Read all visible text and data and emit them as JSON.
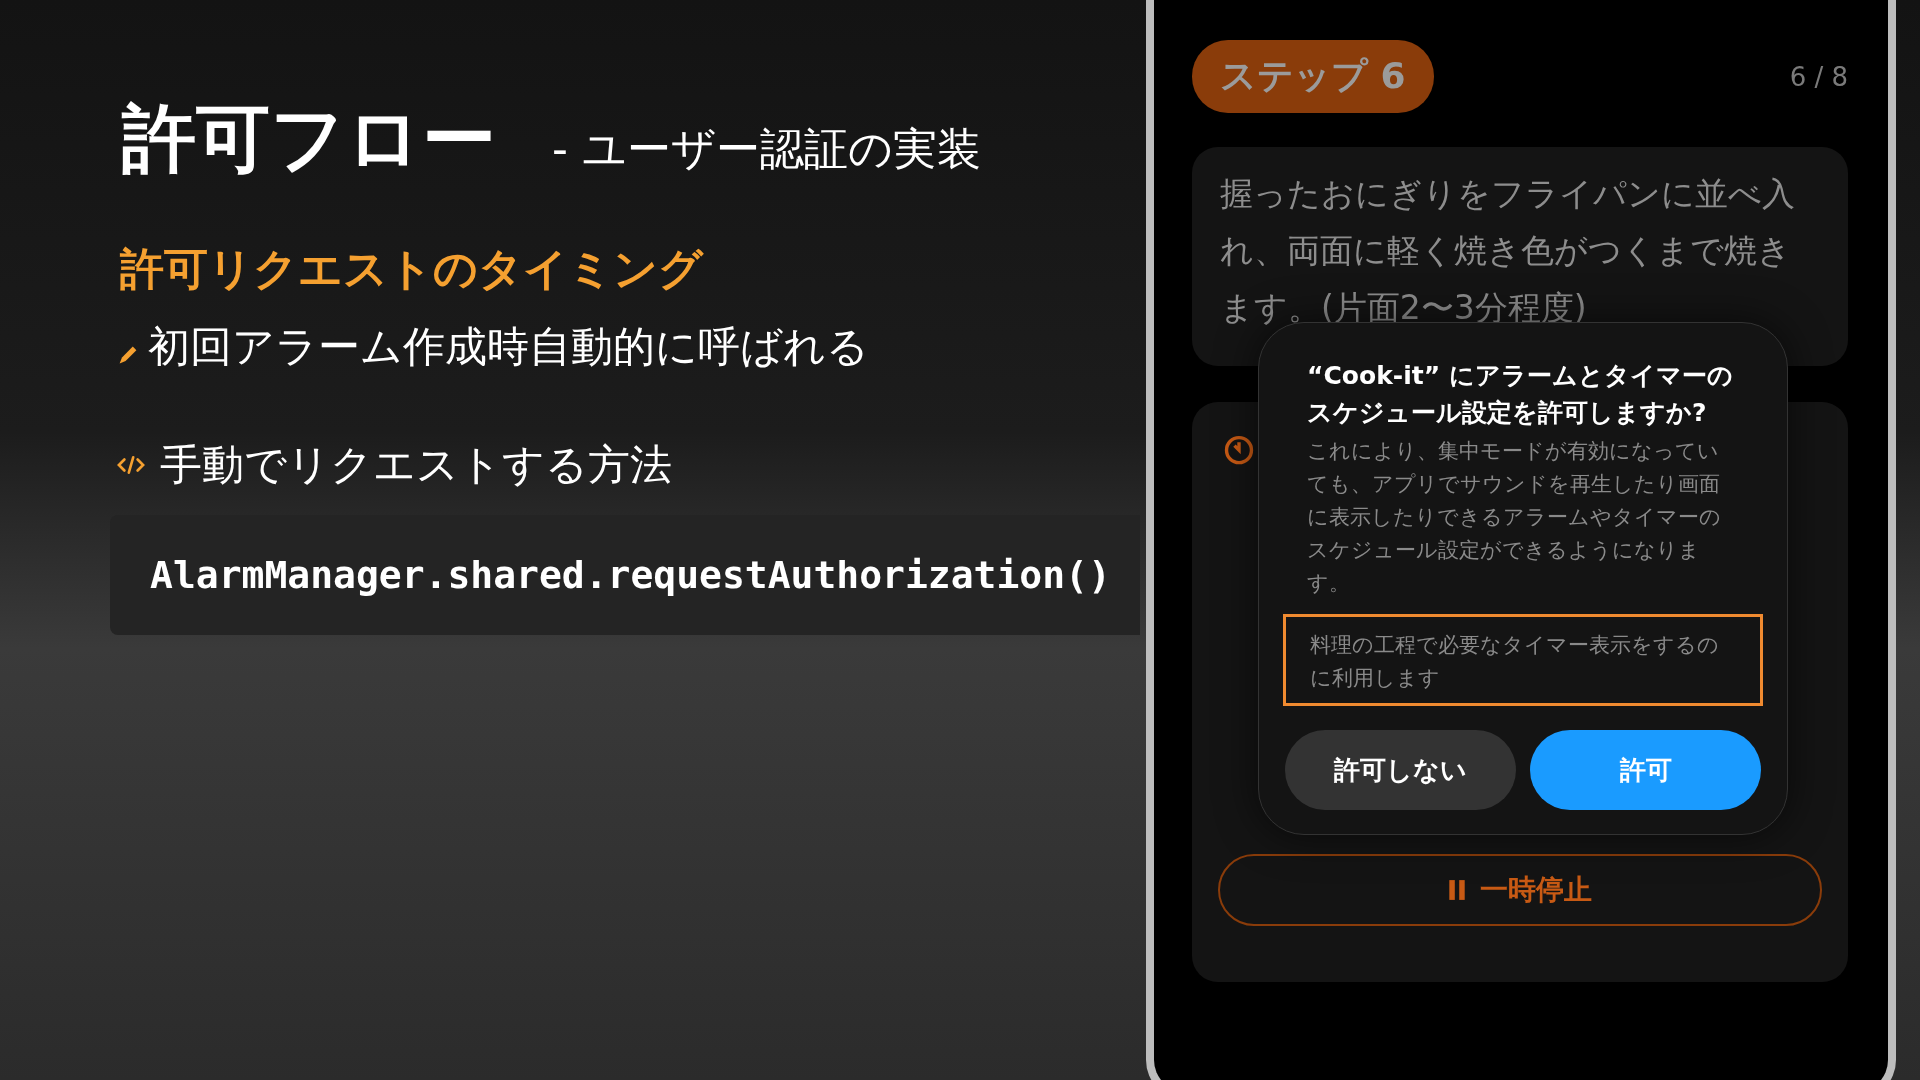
{
  "slide": {
    "title": "許可フロー",
    "subtitle": "- ユーザー認証の実装",
    "heading": "許可リクエストのタイミング",
    "bullets": [
      {
        "kind": "pencil",
        "text": "初回アラーム作成時自動的に呼ばれる"
      },
      {
        "kind": "code",
        "text": "手動でリクエストする方法"
      }
    ],
    "code": "AlarmManager.shared.requestAuthorization()"
  },
  "phone": {
    "step_badge": "ステップ 6",
    "step_counter": "6 / 8",
    "instruction": "握ったおにぎりをフライパンに並べ入れ、両面に軽く焼き色がつくまで焼きます。(片面2〜3分程度)",
    "pause_button": "一時停止",
    "dialog": {
      "title": "“Cook-it” にアラームとタイマーのスケジュール設定を許可しますか?",
      "message": "これにより、集中モードが有効になっていても、アプリでサウンドを再生したり画面に表示したりできるアラームやタイマーのスケジュール設定ができるようになります。",
      "usage_note": "料理の工程で必要なタイマー表示をするのに利用します",
      "buttons": [
        {
          "label": "許可しない",
          "kind": "cancel"
        },
        {
          "label": "許可",
          "kind": "primary"
        }
      ]
    }
  }
}
